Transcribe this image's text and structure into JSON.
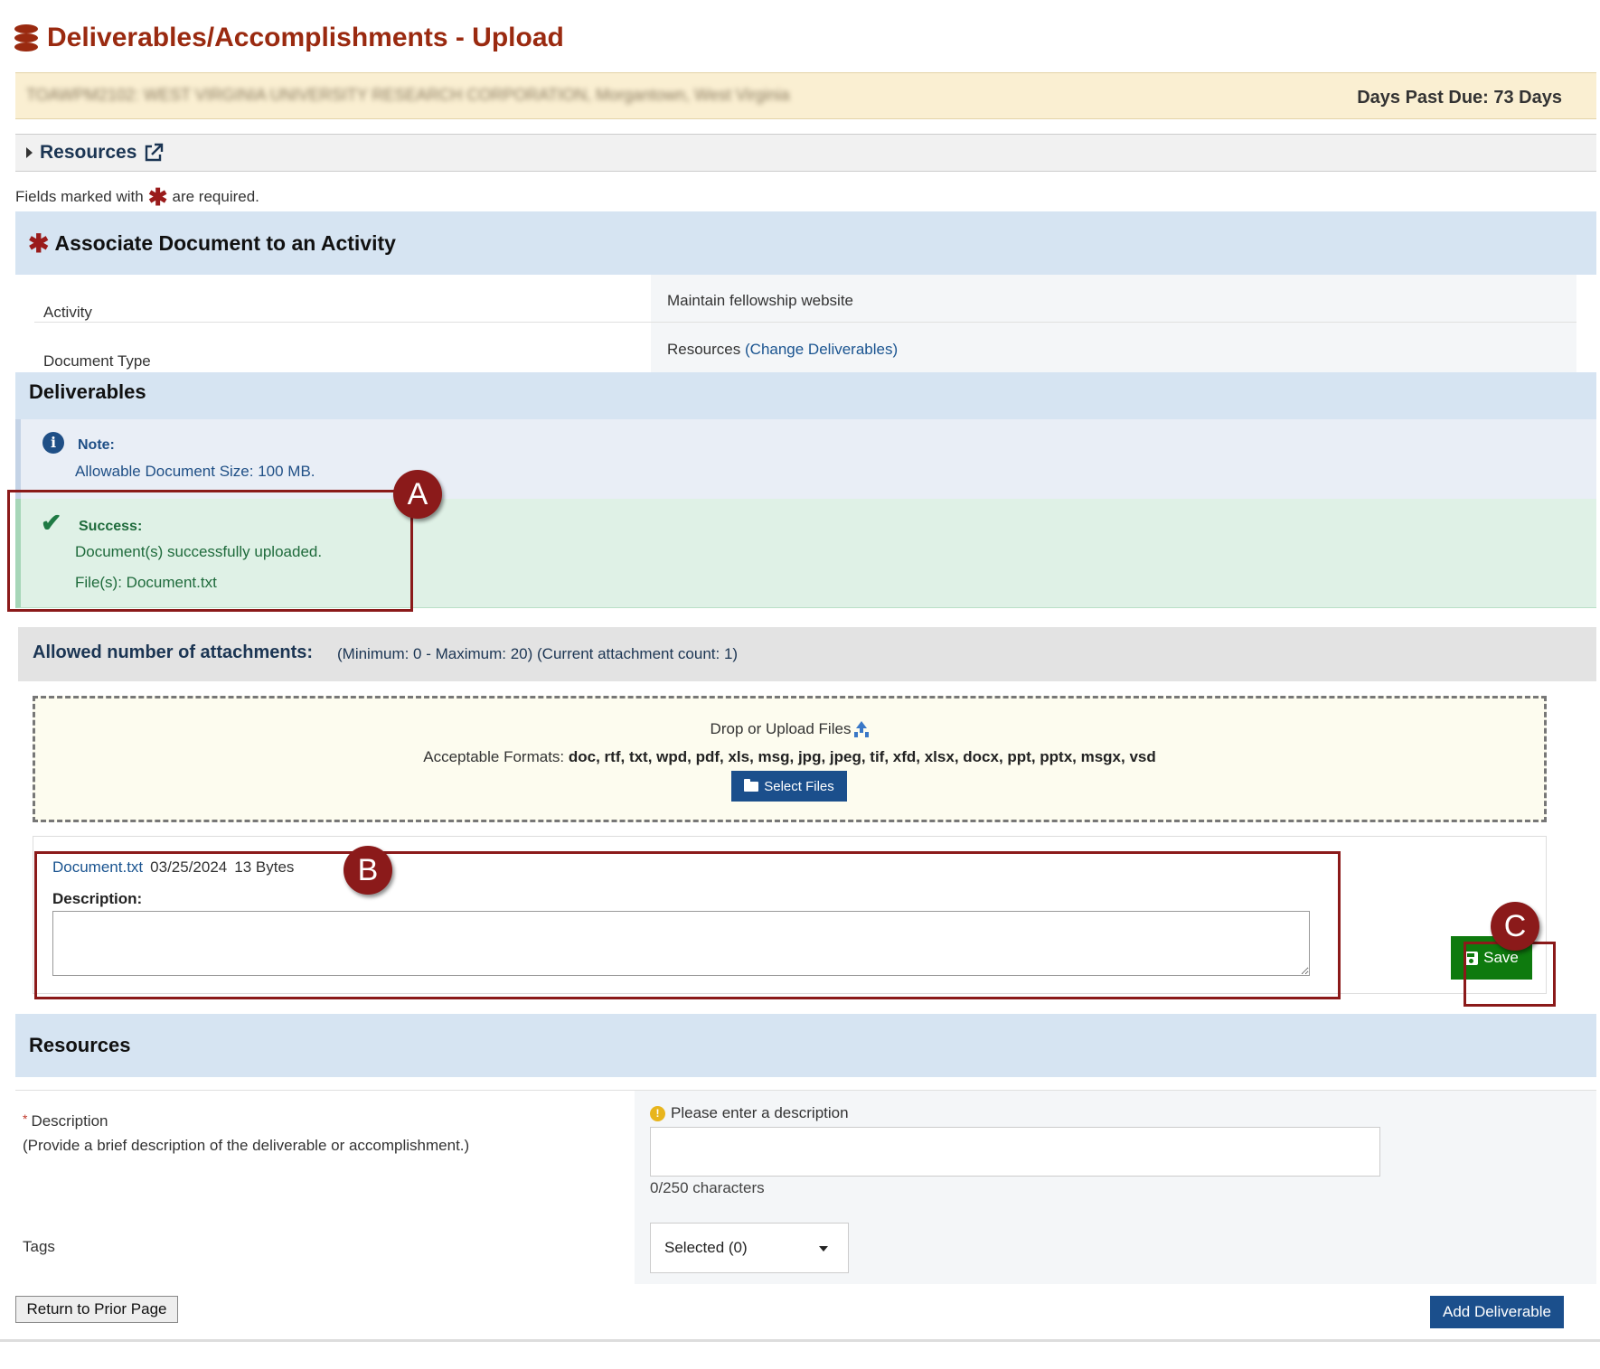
{
  "page": {
    "title": "Deliverables/Accomplishments - Upload",
    "title_icon": "database-icon"
  },
  "banner": {
    "project_text_blurred": "TOAWPM2102: WEST VIRGINIA UNIVERSITY RESEARCH CORPORATION, Morgantown, West Virginia",
    "days_past_due": "Days Past Due: 73 Days"
  },
  "resources_bar": {
    "label": "Resources",
    "icon": "external-link-icon"
  },
  "required_note": {
    "before": "Fields marked with",
    "star": "✱",
    "after": "are required."
  },
  "associate": {
    "heading": "Associate Document to an Activity",
    "rows": [
      {
        "label": "Activity",
        "value": "Maintain fellowship website"
      },
      {
        "label": "Document Type",
        "value": "Resources",
        "link": "(Change Deliverables)"
      }
    ]
  },
  "deliverables": {
    "heading": "Deliverables",
    "note": {
      "title": "Note:",
      "text": "Allowable Document Size: 100 MB."
    },
    "success": {
      "title": "Success:",
      "message": "Document(s) successfully uploaded.",
      "files": "File(s): Document.txt"
    },
    "attachments": {
      "label": "Allowed number of attachments:",
      "details": "(Minimum: 0 - Maximum: 20) (Current attachment count: 1)"
    },
    "dropzone": {
      "title": "Drop or Upload Files",
      "formats_label": "Acceptable Formats:",
      "formats": "doc, rtf, txt, wpd, pdf, xls, msg, jpg, jpeg, tif, xfd, xlsx, docx, ppt, pptx, msgx, vsd",
      "select_button": "Select Files"
    },
    "file": {
      "name": "Document.txt",
      "date": "03/25/2024",
      "size": "13 Bytes",
      "description_label": "Description:",
      "description_value": ""
    },
    "save_button": "Save"
  },
  "callouts": [
    "A",
    "B",
    "C"
  ],
  "resources_section": {
    "heading": "Resources",
    "description_label": "Description",
    "description_required": "*",
    "description_help": "(Provide a brief description of the deliverable or accomplishment.)",
    "description_warning": "Please enter a description",
    "description_value": "",
    "char_count": "0/250 characters",
    "tags_label": "Tags",
    "tags_selected": "Selected (0)"
  },
  "footer": {
    "return_button": "Return to Prior Page",
    "add_button": "Add Deliverable"
  },
  "colors": {
    "title": "#9a2a10",
    "section_header": "#d6e4f2",
    "success_bg": "#dff1e6",
    "save_green": "#0e7a0e",
    "primary_blue": "#1b4f8c",
    "callout": "#8b1a1a"
  }
}
